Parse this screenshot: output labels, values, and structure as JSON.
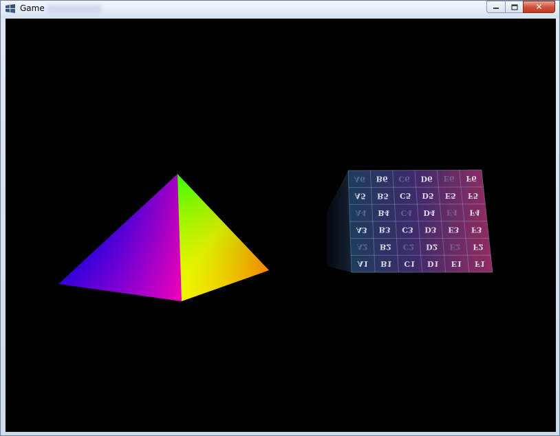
{
  "window": {
    "title": "Game",
    "title_icon": "windows-logo-icon",
    "caption_buttons": {
      "minimize_icon": "minimize-icon",
      "maximize_icon": "maximize-icon",
      "close_icon": "close-icon",
      "close_glyph": "✕",
      "close_color": "#c2381f"
    }
  },
  "scene": {
    "background": "#000000",
    "pyramid": {
      "apex_color": "#00ff00",
      "left_color": "#0000ff",
      "front_color": "#ff00ff",
      "right_color": "#ff0000",
      "front_bottom_color": "#ffff00"
    },
    "cube": {
      "rows": [
        [
          "A6",
          "B6",
          "C6",
          "D6",
          "E6",
          "F6"
        ],
        [
          "A5",
          "B5",
          "C5",
          "D5",
          "E5",
          "F5"
        ],
        [
          "A4",
          "B4",
          "C4",
          "D4",
          "E4",
          "F4"
        ],
        [
          "A3",
          "B3",
          "C3",
          "D3",
          "E3",
          "F3"
        ],
        [
          "A2",
          "B2",
          "C2",
          "D2",
          "E2",
          "F2"
        ],
        [
          "A1",
          "B1",
          "C1",
          "D1",
          "E1",
          "F1"
        ]
      ],
      "tint_left": "#1f3a5a",
      "tint_right": "#8a2a5e"
    }
  }
}
